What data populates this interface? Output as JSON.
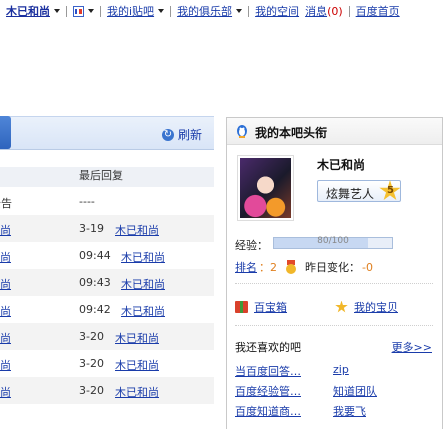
{
  "topbar": {
    "username": "木已和尚",
    "my_tieba": "我的i贴吧",
    "my_club": "我的俱乐部",
    "my_space": "我的空间",
    "messages": "消息",
    "message_count": "(0)",
    "home": "百度首页"
  },
  "left_panel": {
    "refresh": "刷新",
    "last_reply_header": "最后回复",
    "rows": [
      {
        "prefix": "公告",
        "time": "----",
        "user": ""
      },
      {
        "prefix": "尚",
        "time": "3-19",
        "user": "木已和尚"
      },
      {
        "prefix": "尚",
        "time": "09:44",
        "user": "木已和尚"
      },
      {
        "prefix": "尚",
        "time": "09:43",
        "user": "木已和尚"
      },
      {
        "prefix": "尚",
        "time": "09:42",
        "user": "木已和尚"
      },
      {
        "prefix": "尚",
        "time": "3-20",
        "user": "木已和尚"
      },
      {
        "prefix": "尚",
        "time": "3-20",
        "user": "木已和尚"
      },
      {
        "prefix": "尚",
        "time": "3-20",
        "user": "木已和尚"
      }
    ]
  },
  "right_panel": {
    "title": "我的本吧头衔",
    "name": "木已和尚",
    "title_badge": "炫舞艺人",
    "level": "5",
    "exp_label": "经验：",
    "exp_text": "80/100",
    "exp_fraction": 0.8,
    "rank_label": "排名",
    "rank_value": "：2",
    "change_label": "昨日变化：",
    "change_value": "-0",
    "treasure_box": "百宝箱",
    "my_treasure": "我的宝贝",
    "like_title": "我还喜欢的吧",
    "more": "更多>>",
    "likes": [
      {
        "left": "当百度回答…",
        "right": "zip"
      },
      {
        "left": "百度经验管…",
        "right": "知道团队"
      },
      {
        "left": "百度知道商…",
        "right": "我要飞"
      }
    ]
  }
}
